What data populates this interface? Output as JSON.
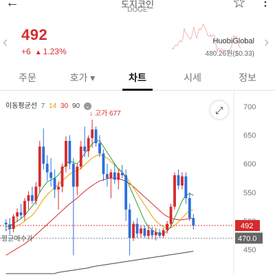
{
  "header": {
    "coin_name": "도지코인",
    "coin_code": "DOGE",
    "back_icon": "back-arrow-icon",
    "favorite_icon": "star-icon",
    "more_icon": "more-vertical-icon"
  },
  "price": {
    "current": "492",
    "change": "+6",
    "change_pct": "1.23%",
    "exchange": "HuobiGlobal",
    "exchange_price": "480.26원($0.33)",
    "color": "#d62b2b"
  },
  "tabs": [
    {
      "label": "주문",
      "active": false
    },
    {
      "label": "호가 ▾",
      "active": false
    },
    {
      "label": "차트",
      "active": true
    },
    {
      "label": "시세",
      "active": false
    },
    {
      "label": "정보",
      "active": false
    }
  ],
  "chart": {
    "ma_label": "이동평균선",
    "ma_periods": [
      {
        "label": "7",
        "color": "#2e9e3e"
      },
      {
        "label": "14",
        "color": "#e6a000"
      },
      {
        "label": "30",
        "color": "#d62b2b"
      },
      {
        "label": "90",
        "color": "#444444"
      }
    ],
    "high_label": "고가 677",
    "avg_buy_label": "평균매수가",
    "y_ticks": [
      "700",
      "650",
      "600",
      "550",
      "500",
      "450"
    ],
    "current_price_tag": "492",
    "avg_price_tag": "470.0",
    "up_color": "#d62b2b",
    "down_color": "#2d6fdb"
  },
  "chart_data": {
    "type": "candlestick",
    "ylim": [
      430,
      720
    ],
    "y_ticks": [
      700,
      650,
      600,
      550,
      500,
      450
    ],
    "candles": [
      {
        "o": 497,
        "h": 503,
        "l": 482,
        "c": 494
      },
      {
        "o": 494,
        "h": 505,
        "l": 476,
        "c": 486
      },
      {
        "o": 486,
        "h": 512,
        "l": 480,
        "c": 508
      },
      {
        "o": 508,
        "h": 522,
        "l": 498,
        "c": 515
      },
      {
        "o": 515,
        "h": 530,
        "l": 505,
        "c": 510
      },
      {
        "o": 510,
        "h": 540,
        "l": 500,
        "c": 535
      },
      {
        "o": 535,
        "h": 552,
        "l": 520,
        "c": 545
      },
      {
        "o": 545,
        "h": 560,
        "l": 530,
        "c": 535
      },
      {
        "o": 535,
        "h": 568,
        "l": 528,
        "c": 560
      },
      {
        "o": 560,
        "h": 640,
        "l": 550,
        "c": 630
      },
      {
        "o": 630,
        "h": 662,
        "l": 590,
        "c": 600
      },
      {
        "o": 600,
        "h": 615,
        "l": 570,
        "c": 585
      },
      {
        "o": 585,
        "h": 610,
        "l": 560,
        "c": 575
      },
      {
        "o": 575,
        "h": 590,
        "l": 540,
        "c": 555
      },
      {
        "o": 555,
        "h": 570,
        "l": 520,
        "c": 560
      },
      {
        "o": 560,
        "h": 600,
        "l": 550,
        "c": 595
      },
      {
        "o": 595,
        "h": 648,
        "l": 585,
        "c": 640
      },
      {
        "o": 640,
        "h": 650,
        "l": 590,
        "c": 600
      },
      {
        "o": 600,
        "h": 610,
        "l": 440,
        "c": 560
      },
      {
        "o": 560,
        "h": 600,
        "l": 545,
        "c": 595
      },
      {
        "o": 595,
        "h": 640,
        "l": 590,
        "c": 630
      },
      {
        "o": 630,
        "h": 665,
        "l": 612,
        "c": 622
      },
      {
        "o": 622,
        "h": 650,
        "l": 612,
        "c": 645
      },
      {
        "o": 645,
        "h": 677,
        "l": 628,
        "c": 660
      },
      {
        "o": 660,
        "h": 665,
        "l": 630,
        "c": 636
      },
      {
        "o": 636,
        "h": 650,
        "l": 612,
        "c": 618
      },
      {
        "o": 618,
        "h": 625,
        "l": 570,
        "c": 582
      },
      {
        "o": 582,
        "h": 600,
        "l": 560,
        "c": 575
      },
      {
        "o": 575,
        "h": 590,
        "l": 540,
        "c": 585
      },
      {
        "o": 585,
        "h": 600,
        "l": 565,
        "c": 572
      },
      {
        "o": 572,
        "h": 590,
        "l": 555,
        "c": 584
      },
      {
        "o": 584,
        "h": 598,
        "l": 575,
        "c": 580
      },
      {
        "o": 580,
        "h": 590,
        "l": 500,
        "c": 520
      },
      {
        "o": 520,
        "h": 530,
        "l": 440,
        "c": 470
      },
      {
        "o": 470,
        "h": 500,
        "l": 465,
        "c": 495
      },
      {
        "o": 495,
        "h": 505,
        "l": 470,
        "c": 478
      },
      {
        "o": 478,
        "h": 492,
        "l": 470,
        "c": 487
      },
      {
        "o": 487,
        "h": 492,
        "l": 470,
        "c": 474
      },
      {
        "o": 474,
        "h": 492,
        "l": 468,
        "c": 484
      },
      {
        "o": 484,
        "h": 490,
        "l": 468,
        "c": 475
      },
      {
        "o": 475,
        "h": 488,
        "l": 466,
        "c": 480
      },
      {
        "o": 480,
        "h": 486,
        "l": 470,
        "c": 474
      },
      {
        "o": 474,
        "h": 488,
        "l": 470,
        "c": 484
      },
      {
        "o": 484,
        "h": 500,
        "l": 478,
        "c": 495
      },
      {
        "o": 495,
        "h": 530,
        "l": 488,
        "c": 525
      },
      {
        "o": 525,
        "h": 585,
        "l": 520,
        "c": 580
      },
      {
        "o": 580,
        "h": 590,
        "l": 555,
        "c": 562
      },
      {
        "o": 562,
        "h": 585,
        "l": 555,
        "c": 578
      },
      {
        "o": 578,
        "h": 585,
        "l": 530,
        "c": 540
      },
      {
        "o": 540,
        "h": 550,
        "l": 500,
        "c": 505
      },
      {
        "o": 505,
        "h": 512,
        "l": 485,
        "c": 492
      }
    ],
    "ma7": [
      490,
      492,
      495,
      500,
      504,
      510,
      518,
      526,
      535,
      550,
      560,
      568,
      572,
      575,
      580,
      590,
      600,
      605,
      602,
      600,
      608,
      618,
      626,
      635,
      640,
      640,
      630,
      620,
      610,
      600,
      590,
      585,
      575,
      560,
      545,
      530,
      515,
      500,
      490,
      484,
      480,
      478,
      478,
      482,
      490,
      505,
      520,
      535,
      545,
      548,
      545
    ],
    "ma14": [
      484,
      486,
      488,
      492,
      495,
      500,
      505,
      510,
      518,
      528,
      538,
      546,
      552,
      558,
      564,
      570,
      576,
      582,
      586,
      588,
      592,
      598,
      604,
      610,
      614,
      616,
      614,
      610,
      604,
      598,
      592,
      586,
      578,
      568,
      558,
      548,
      538,
      528,
      518,
      508,
      500,
      494,
      490,
      488,
      488,
      492,
      498,
      505,
      512,
      518,
      520
    ],
    "ma30": [
      440,
      444,
      448,
      452,
      456,
      460,
      465,
      470,
      476,
      482,
      488,
      494,
      500,
      506,
      512,
      518,
      524,
      530,
      535,
      540,
      546,
      552,
      557,
      562,
      566,
      570,
      572,
      574,
      575,
      575,
      574,
      572,
      569,
      565,
      560,
      554,
      548,
      542,
      536,
      530,
      524,
      518,
      512,
      508,
      505,
      503,
      502,
      502,
      503,
      504,
      505
    ],
    "ma90": [
      395,
      396,
      397,
      398,
      399,
      400,
      401,
      402,
      403,
      404,
      405,
      406,
      407,
      408,
      410,
      411,
      412,
      413,
      414,
      415,
      416,
      417,
      418,
      420,
      421,
      422,
      423,
      424,
      425,
      426,
      427,
      428,
      429,
      430,
      431,
      432,
      433,
      434,
      435,
      436,
      437,
      438,
      439,
      440,
      441,
      442,
      443,
      444,
      445,
      446,
      447
    ],
    "current_price": 492,
    "avg_buy_price": 470.0
  }
}
